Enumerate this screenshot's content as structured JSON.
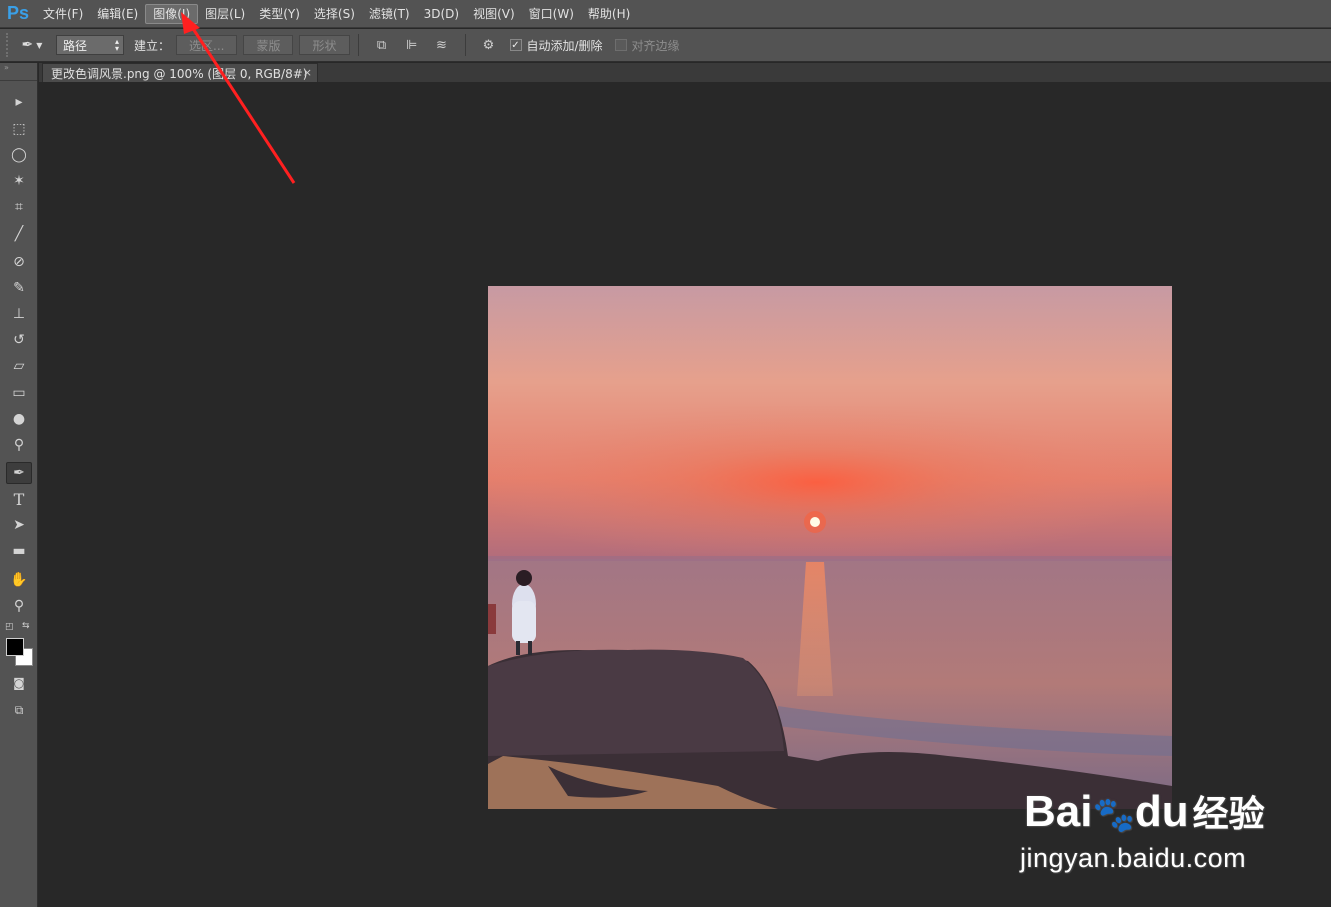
{
  "app": {
    "logo": "Ps"
  },
  "menubar": {
    "items": [
      {
        "label": "文件(F)"
      },
      {
        "label": "编辑(E)"
      },
      {
        "label": "图像(I)",
        "active": true
      },
      {
        "label": "图层(L)"
      },
      {
        "label": "类型(Y)"
      },
      {
        "label": "选择(S)"
      },
      {
        "label": "滤镜(T)"
      },
      {
        "label": "3D(D)"
      },
      {
        "label": "视图(V)"
      },
      {
        "label": "窗口(W)"
      },
      {
        "label": "帮助(H)"
      }
    ]
  },
  "options": {
    "mode_value": "路径",
    "make_label": "建立：",
    "selection_button": "选区...",
    "mask_button": "蒙版",
    "shape_button": "形状",
    "auto_add_delete_label": "自动添加/删除",
    "auto_add_delete_checked": true,
    "align_edges_label": "对齐边缘",
    "align_edges_checked": false
  },
  "document": {
    "tab_title": "更改色调风景.png @ 100% (图层 0, RGB/8#)",
    "close_glyph": "×"
  },
  "tools": [
    {
      "name": "move-tool",
      "glyph": "▸"
    },
    {
      "name": "marquee-tool",
      "glyph": "⬚"
    },
    {
      "name": "lasso-tool",
      "glyph": "◯"
    },
    {
      "name": "magic-wand-tool",
      "glyph": "✶"
    },
    {
      "name": "crop-tool",
      "glyph": "⌗"
    },
    {
      "name": "eyedropper-tool",
      "glyph": "╱"
    },
    {
      "name": "healing-brush-tool",
      "glyph": "⊘"
    },
    {
      "name": "brush-tool",
      "glyph": "✎"
    },
    {
      "name": "stamp-tool",
      "glyph": "⊥"
    },
    {
      "name": "history-brush-tool",
      "glyph": "↺"
    },
    {
      "name": "eraser-tool",
      "glyph": "▱"
    },
    {
      "name": "gradient-tool",
      "glyph": "▭"
    },
    {
      "name": "blur-tool",
      "glyph": "●"
    },
    {
      "name": "dodge-tool",
      "glyph": "⚲"
    },
    {
      "name": "pen-tool",
      "glyph": "✒",
      "selected": true
    },
    {
      "name": "type-tool",
      "glyph": "T"
    },
    {
      "name": "path-selection-tool",
      "glyph": "➤"
    },
    {
      "name": "shape-tool",
      "glyph": "▬"
    },
    {
      "name": "hand-tool",
      "glyph": "✋"
    },
    {
      "name": "zoom-tool",
      "glyph": "⚲"
    }
  ],
  "watermark": {
    "logo_text": "Bai",
    "logo_suffix": "du",
    "logo_cn": "经验",
    "url": "jingyan.baidu.com"
  },
  "colors": {
    "annotation_arrow": "#ff2020",
    "foreground": "#000000",
    "background": "#ffffff"
  }
}
